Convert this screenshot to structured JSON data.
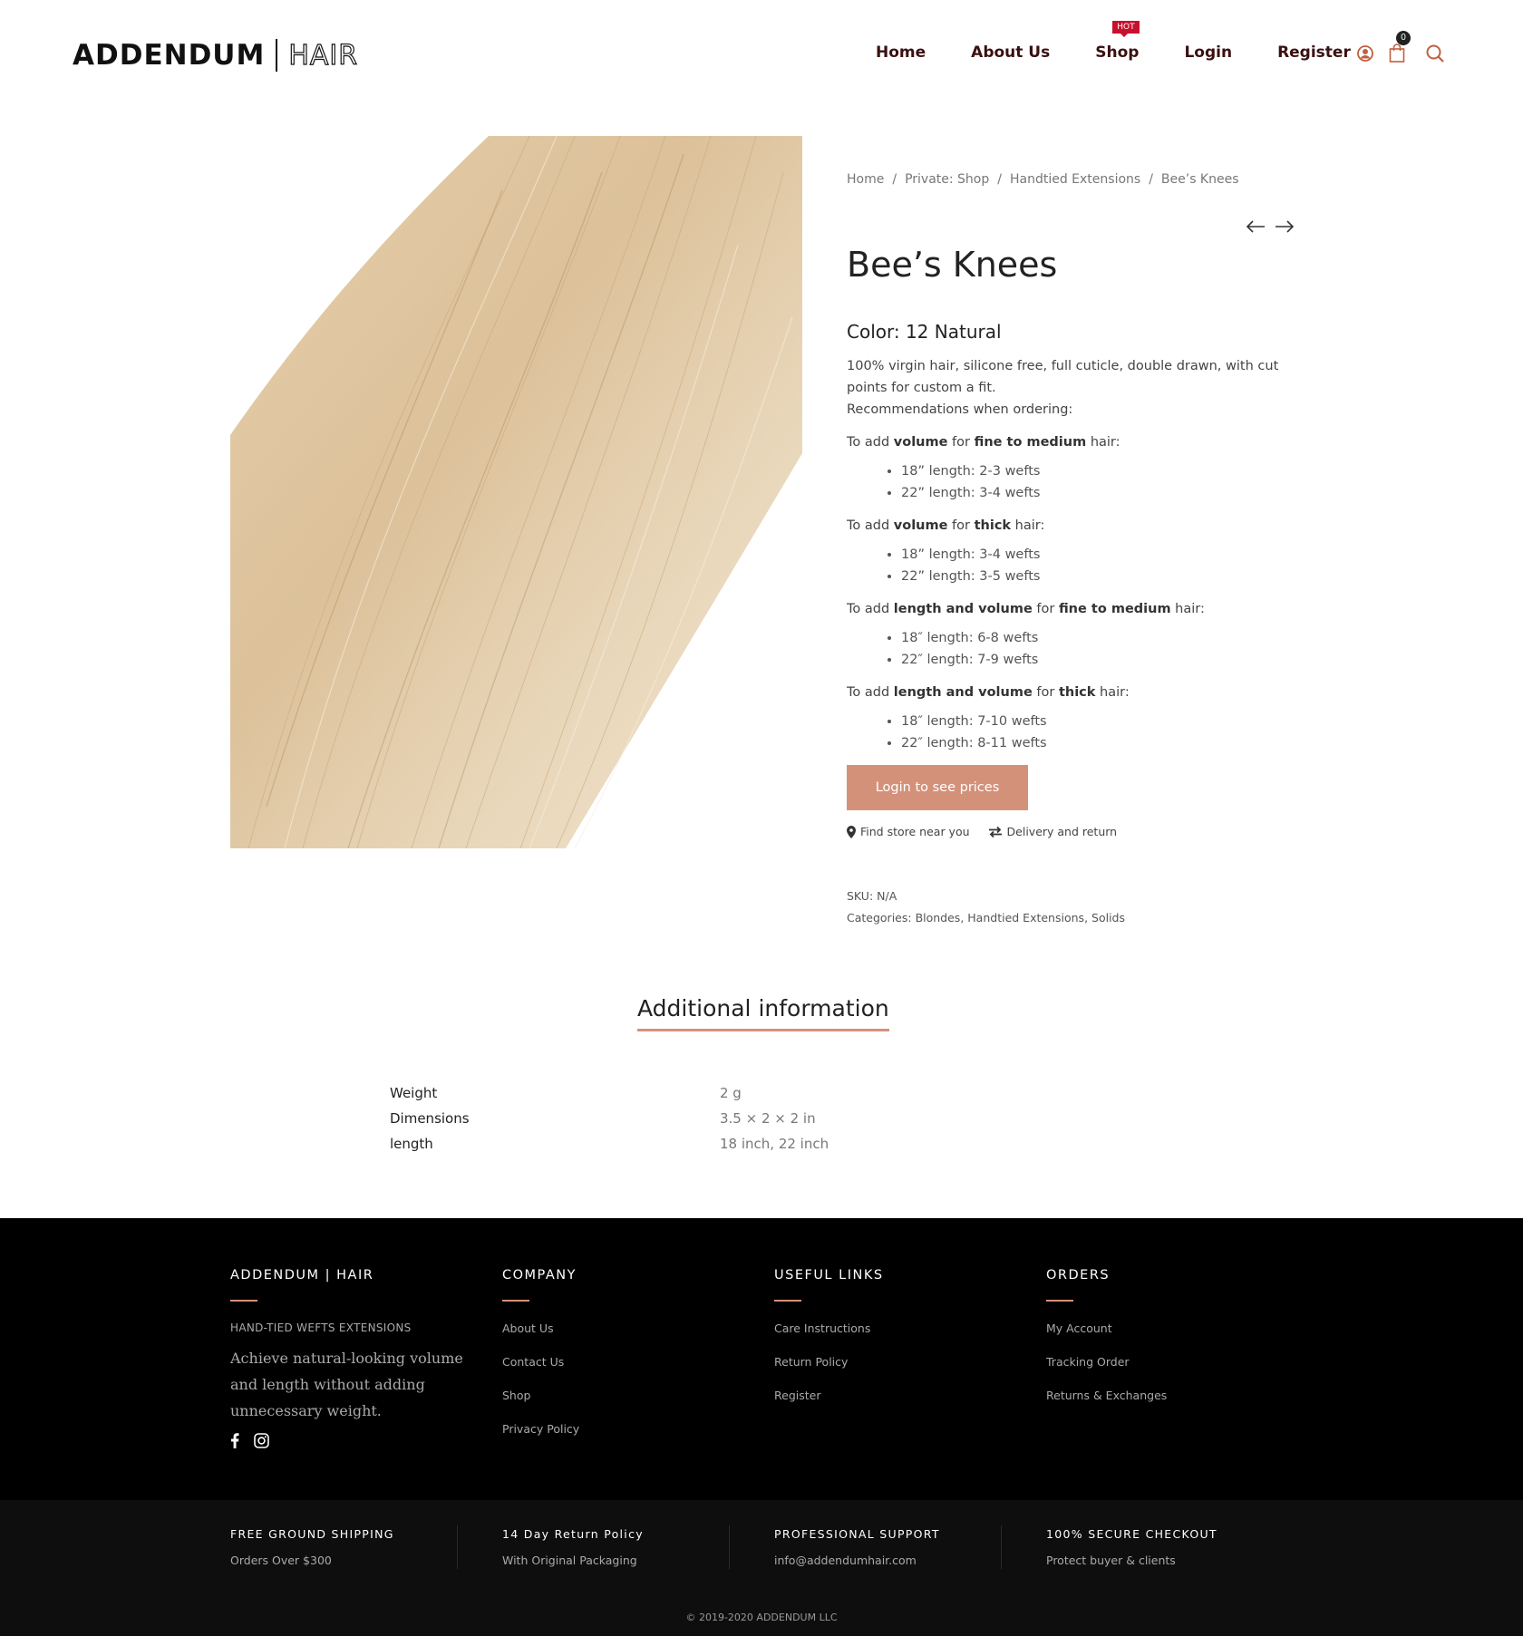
{
  "header": {
    "logo_primary": "ADDENDUM",
    "logo_secondary": "HAIR",
    "nav": [
      {
        "label": "Home"
      },
      {
        "label": "About Us"
      },
      {
        "label": "Shop",
        "badge": "HOT"
      },
      {
        "label": "Login"
      },
      {
        "label": "Register"
      }
    ],
    "cart_count": "0",
    "accent_color": "#d4917a"
  },
  "breadcrumb": [
    "Home",
    "Private: Shop",
    "Handtied Extensions",
    "Bee’s Knees"
  ],
  "product": {
    "title": "Bee’s Knees",
    "color": "Color: 12 Natural",
    "description_1": "100% virgin hair, silicone free, full cuticle, double drawn, with cut points for custom a fit.",
    "description_2": "Recommendations when ordering:",
    "recommendations": [
      {
        "prefix": "To add ",
        "b1": "volume",
        "mid": " for ",
        "b2": "fine to medium",
        "suffix": " hair:",
        "items": [
          "18” length:  2-3 wefts",
          "22” length: 3-4 wefts"
        ]
      },
      {
        "prefix": "To add ",
        "b1": "volume",
        "mid": " for ",
        "b2": "thick",
        "suffix": " hair:",
        "items": [
          "18” length: 3-4 wefts",
          "22” length: 3-5 wefts"
        ]
      },
      {
        "prefix": "To add ",
        "b1": "length and volume",
        "mid": " for ",
        "b2": "fine to medium",
        "suffix": " hair:",
        "items": [
          "18″ length: 6-8 wefts",
          "22″ length: 7-9 wefts"
        ]
      },
      {
        "prefix": "To add ",
        "b1": "length and volume",
        "mid": " for ",
        "b2": "thick",
        "suffix": " hair:",
        "items": [
          "18″ length: 7-10 wefts",
          "22″ length: 8-11 wefts"
        ]
      }
    ],
    "cta": "Login to see prices",
    "find_store": "Find store near you",
    "delivery": "Delivery and return",
    "sku": "SKU: N/A",
    "categories_label": "Categories: ",
    "categories": [
      "Blondes",
      "Handtied Extensions",
      "Solids"
    ]
  },
  "additional_info": {
    "tab_label": "Additional information",
    "rows": [
      {
        "label": "Weight",
        "value": "2 g"
      },
      {
        "label": "Dimensions",
        "value": "3.5 × 2 × 2 in"
      },
      {
        "label": "length",
        "value": "18 inch, 22 inch"
      }
    ]
  },
  "footer": {
    "brand": {
      "title": "ADDENDUM | HAIR",
      "tagline": "HAND-TIED WEFTS EXTENSIONS",
      "blurb": "Achieve natural-looking volume and length without adding unnecessary weight."
    },
    "columns": [
      {
        "title": "COMPANY",
        "links": [
          "About Us",
          "Contact Us",
          "Shop",
          "Privacy Policy"
        ]
      },
      {
        "title": "USEFUL LINKS",
        "links": [
          "Care Instructions",
          "Return Policy",
          "Register"
        ]
      },
      {
        "title": "ORDERS",
        "links": [
          "My Account",
          "Tracking Order",
          "Returns & Exchanges"
        ]
      }
    ],
    "features": [
      {
        "title": "FREE GROUND SHIPPING",
        "sub": "Orders Over $300"
      },
      {
        "title": "14 Day Return Policy",
        "sub": "With Original Packaging"
      },
      {
        "title": "PROFESSIONAL SUPPORT",
        "sub": "info@addendumhair.com"
      },
      {
        "title": "100% SECURE CHECKOUT",
        "sub": "Protect buyer & clients"
      }
    ],
    "copyright": "© 2019-2020 ADDENDUM LLC"
  }
}
